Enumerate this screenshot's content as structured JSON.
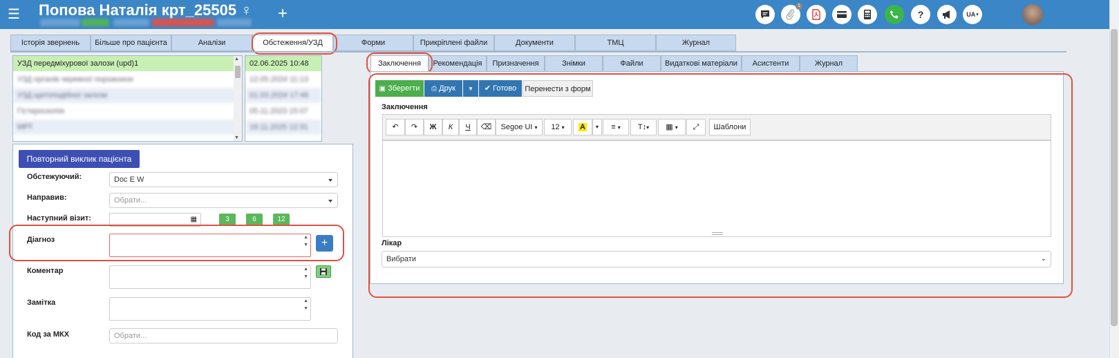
{
  "header": {
    "patient_name": "Попова Наталія крт_25505 ♀",
    "notification_count": "1",
    "lang": "UA"
  },
  "main_tabs": [
    "Історія звернень",
    "Більше про пацієнта",
    "Аналізи",
    "Обстеження/УЗД",
    "Форми",
    "Прикріплені файли",
    "Документи",
    "ТМЦ",
    "Журнал"
  ],
  "studies": {
    "selected_name": "УЗД передміхурової залози (upd)1",
    "selected_date": "02.06.2025 10:48",
    "rows": [
      {
        "name": "УЗД органів черевної порожнини",
        "date": "12.05.2024 11:13"
      },
      {
        "name": "УЗД щитоподібної залози",
        "date": "01.03.2024 17:46"
      },
      {
        "name": "Гістероскопія",
        "date": "05.11.2023 15:07"
      },
      {
        "name": "МРТ",
        "date": "18.11.2025 12:31"
      }
    ]
  },
  "left_form": {
    "recall_button": "Повторний виклик пацієнта",
    "examiner_label": "Обстежуючий:",
    "examiner_value": "Doc E W",
    "referred_label": "Направив:",
    "referred_placeholder": "Обрати...",
    "next_visit_label": "Наступний візит:",
    "quick_months": [
      "3",
      "6",
      "12"
    ],
    "diagnosis_label": "Діагноз",
    "comment_label": "Коментар",
    "note_label": "Замітка",
    "icd_label": "Код за МКХ",
    "icd_placeholder": "Обрати...",
    "add_symbol": "+"
  },
  "sub_tabs": [
    "Заключення",
    "Рекомендація",
    "Призначення",
    "Знімки",
    "Файли",
    "Видаткові матеріали",
    "Асистенти",
    "Журнал"
  ],
  "conclusion": {
    "save_label": "Зберегти",
    "print_label": "Друк",
    "done_label": "Готово",
    "transfer_label": "Перенести з форм",
    "section_label": "Заключення",
    "font_name": "Segoe UI",
    "font_size": "12",
    "bold_glyph": "Ж",
    "italic_glyph": "К",
    "underline_glyph": "Ч",
    "templates_label": "Шаблони",
    "doctor_label": "Лікар",
    "doctor_placeholder": "Вибрати"
  },
  "colors": {
    "header": "#3b86c6",
    "tab_inactive": "#c6d9ee",
    "selected_row": "#c9f0b4",
    "recall_button": "#3e4fb3",
    "save_green": "#4cae4c",
    "print_blue": "#3276b1",
    "highlight_red": "#e05040"
  }
}
